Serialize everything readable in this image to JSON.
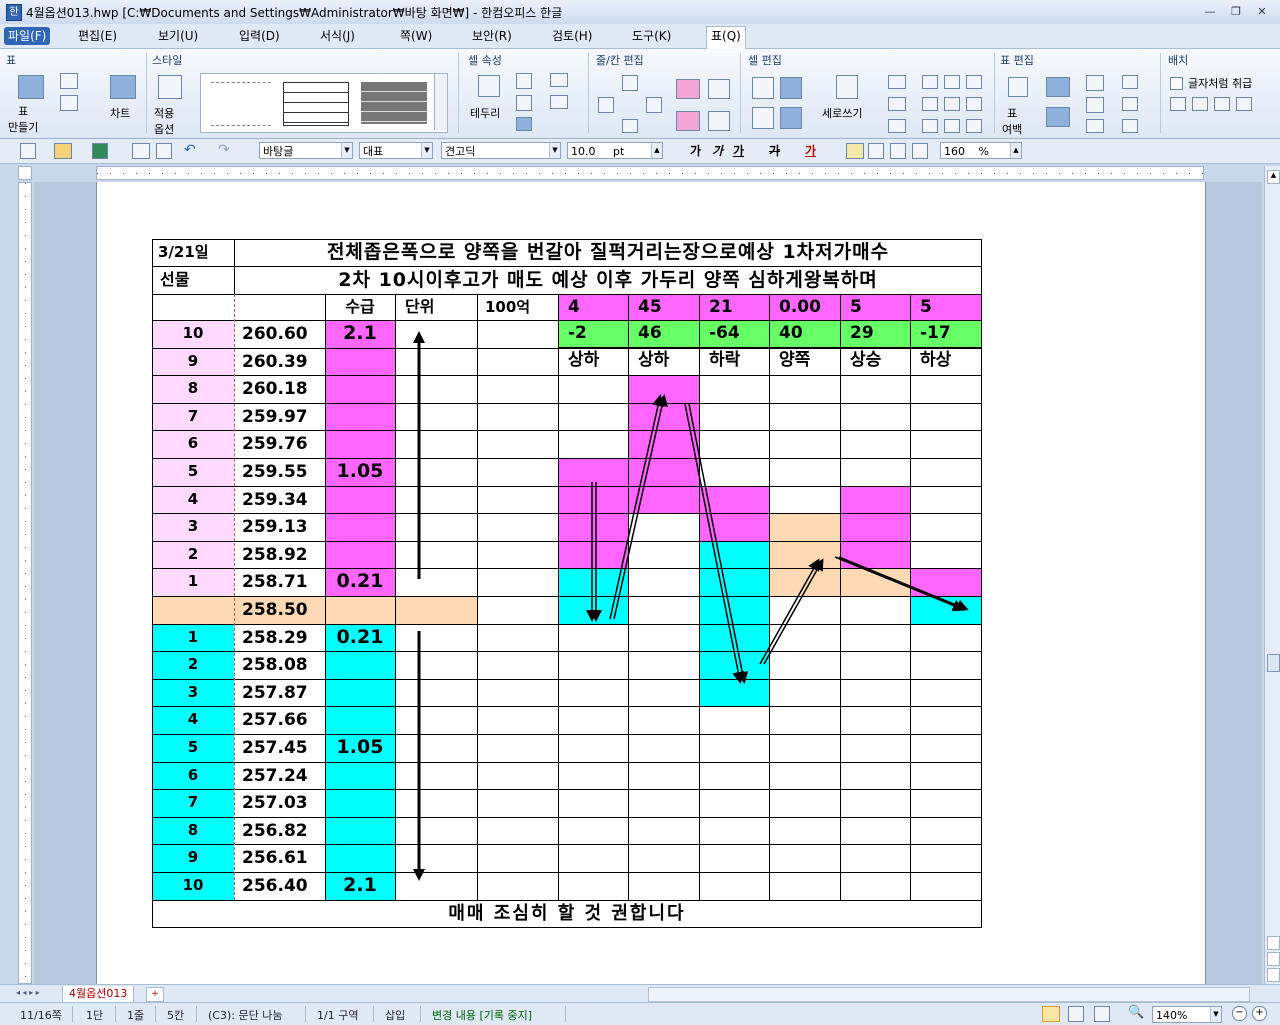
{
  "window": {
    "title": "4월옵션013.hwp [C:₩Documents and Settings₩Administrator₩바탕 화면₩] - 한컴오피스 한글",
    "app_icon": "hwp-icon"
  },
  "menubar": {
    "items": [
      "파일(F)",
      "편집(E)",
      "보기(U)",
      "입력(D)",
      "서식(J)",
      "쪽(W)",
      "보안(R)",
      "검토(H)",
      "도구(K)",
      "표(Q)"
    ]
  },
  "ribbon": {
    "groups": {
      "table": "표",
      "style": "스타일",
      "cell_attr": "셀 속성",
      "rowcol_edit": "줄/칸 편집",
      "cell_edit": "셀 편집",
      "table_edit": "표 편집",
      "arrange": "배치"
    },
    "buttons": {
      "make_table": "표\n만들기",
      "chart": "차트",
      "apply_options": "적용\n옵션",
      "border": "테두리",
      "vertical_writing": "세로쓰기",
      "table_margin": "표\n여백",
      "treat_as_char": "글자처럼 취급"
    }
  },
  "toolbar": {
    "style": "바탕글",
    "lang": "대표",
    "font": "견고딕",
    "size": "10.0",
    "size_unit": "pt",
    "bold": "가",
    "italic": "가",
    "underline": "가",
    "strike": "가",
    "color": "가",
    "zoom_line": "160",
    "zoom_unit": "%"
  },
  "doc": {
    "title_row1_left": "3/21일",
    "title_row1_right": "전체좁은폭으로 양쪽을 번갈아 질퍽거리는장으로예상 1차저가매수",
    "title_row2_left": "선물",
    "title_row2_right": "2차 10시이후고가 매도 예상  이후 가두리 양쪽 심하게왕복하며",
    "header3": {
      "col3": "수급",
      "col4": "단위",
      "col5": "100억"
    },
    "top_values": [
      "4",
      "45",
      "21",
      "0.00",
      "5",
      "5"
    ],
    "second_values": [
      "-2",
      "46",
      "-64",
      "40",
      "29",
      "-17"
    ],
    "labels": [
      "상하",
      "상하",
      "하락",
      "양쪽",
      "상승",
      "하상"
    ],
    "rows": [
      {
        "n": "10",
        "price": "260.60",
        "supply": "2.1"
      },
      {
        "n": "9",
        "price": "260.39",
        "supply": ""
      },
      {
        "n": "8",
        "price": "260.18",
        "supply": ""
      },
      {
        "n": "7",
        "price": "259.97",
        "supply": ""
      },
      {
        "n": "6",
        "price": "259.76",
        "supply": ""
      },
      {
        "n": "5",
        "price": "259.55",
        "supply": "1.05"
      },
      {
        "n": "4",
        "price": "259.34",
        "supply": ""
      },
      {
        "n": "3",
        "price": "259.13",
        "supply": ""
      },
      {
        "n": "2",
        "price": "258.92",
        "supply": ""
      },
      {
        "n": "1",
        "price": "258.71",
        "supply": "0.21"
      },
      {
        "n": "",
        "price": "258.50",
        "supply": ""
      },
      {
        "n": "1",
        "price": "258.29",
        "supply": "0.21"
      },
      {
        "n": "2",
        "price": "258.08",
        "supply": ""
      },
      {
        "n": "3",
        "price": "257.87",
        "supply": ""
      },
      {
        "n": "4",
        "price": "257.66",
        "supply": ""
      },
      {
        "n": "5",
        "price": "257.45",
        "supply": "1.05"
      },
      {
        "n": "6",
        "price": "257.24",
        "supply": ""
      },
      {
        "n": "7",
        "price": "257.03",
        "supply": ""
      },
      {
        "n": "8",
        "price": "256.82",
        "supply": ""
      },
      {
        "n": "9",
        "price": "256.61",
        "supply": ""
      },
      {
        "n": "10",
        "price": "256.40",
        "supply": "2.1"
      }
    ],
    "footer": "매매 조심히 할 것 권합니다"
  },
  "colors": {
    "magenta": "#ff66ff",
    "light_pink": "#ffd9ff",
    "cyan": "#00ffff",
    "peach": "#ffd9b3",
    "green": "#66ff66"
  },
  "doc_tab": "4월옵션013",
  "status": {
    "page": "11/16쪽",
    "column": "1단",
    "line": "1줄",
    "col": "5칸",
    "cell": "(C3): 문단 나눔",
    "section": "1/1 구역",
    "mode": "삽입",
    "track": "변경 내용 [기록 중지]",
    "zoom": "140%"
  }
}
